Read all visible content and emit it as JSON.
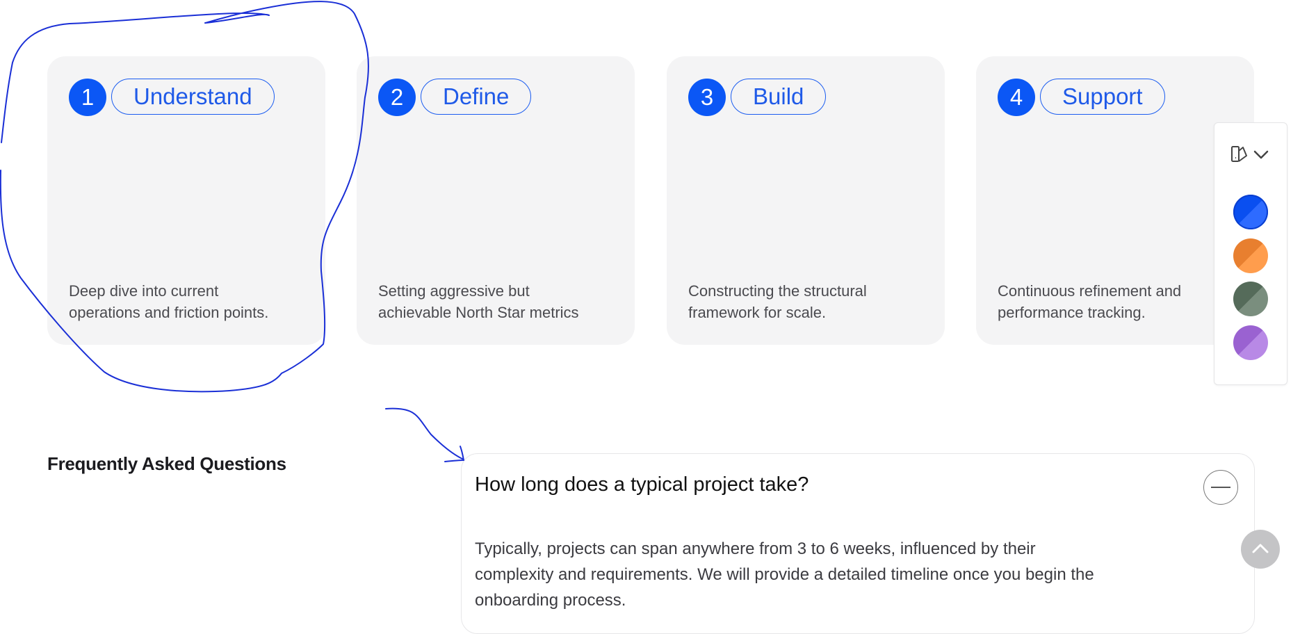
{
  "steps": [
    {
      "number": "1",
      "title": "Understand",
      "description": "Deep dive into current operations and friction points."
    },
    {
      "number": "2",
      "title": "Define",
      "description": "Setting aggressive but achievable North Star metrics"
    },
    {
      "number": "3",
      "title": "Build",
      "description": "Constructing the structural framework for scale."
    },
    {
      "number": "4",
      "title": "Support",
      "description": "Continuous refinement and performance tracking."
    }
  ],
  "palette": {
    "icons": [
      "paint-bucket-icon",
      "chevron-down-icon"
    ],
    "swatches": [
      {
        "name": "blue",
        "color_a": "#0a4ff0",
        "color_b": "#2e6bff",
        "selected": true
      },
      {
        "name": "orange",
        "color_a": "#e87f2f",
        "color_b": "#ff9d4d"
      },
      {
        "name": "green",
        "color_a": "#556b5a",
        "color_b": "#7a8e7e"
      },
      {
        "name": "purple",
        "color_a": "#9a62d1",
        "color_b": "#b889e6"
      }
    ]
  },
  "faq": {
    "heading": "Frequently Asked Questions",
    "items": [
      {
        "question": "How long does a typical project take?",
        "answer": "Typically, projects can span anywhere from 3 to 6 weeks, influenced by their complexity and requirements. We will provide a detailed timeline once you begin the onboarding process.",
        "expanded": true
      }
    ]
  },
  "colors": {
    "accent": "#0b57f5",
    "card_bg": "#f4f4f5",
    "annotation": "#1a2fd6"
  },
  "icons": {
    "scroll_top": "chevron-up-icon",
    "faq_toggle": "minus-icon"
  }
}
